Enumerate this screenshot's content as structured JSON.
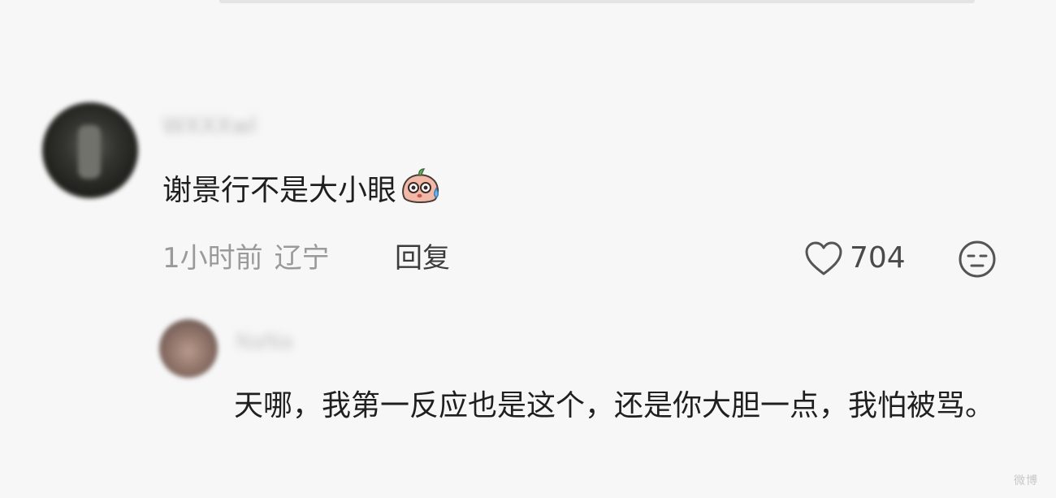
{
  "comment": {
    "username": "WXXXwl",
    "text": "谢景行不是大小眼",
    "emoji_icon": "sweat-drop-face-icon",
    "time": "1小时前",
    "location": "辽宁",
    "reply_label": "回复",
    "like_count": "704",
    "like_icon": "heart-outline-icon",
    "dislike_icon": "unamused-face-icon"
  },
  "reply": {
    "username": "NaNa",
    "text": "天哪，我第一反应也是这个，还是你大胆一点，我怕被骂。"
  },
  "watermark": "微博"
}
